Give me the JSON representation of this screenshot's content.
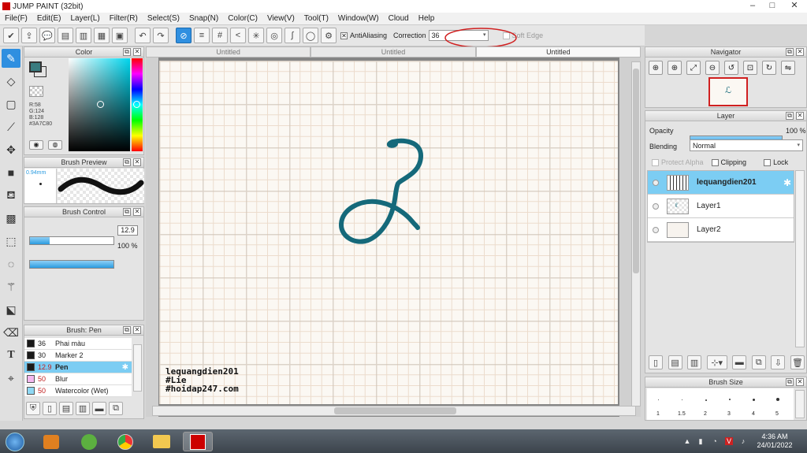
{
  "app": {
    "title": "JUMP PAINT (32bit)",
    "window_controls": [
      "–",
      "□",
      "✕"
    ]
  },
  "menu": [
    "File(F)",
    "Edit(E)",
    "Layer(L)",
    "Filter(R)",
    "Select(S)",
    "Snap(N)",
    "Color(C)",
    "View(V)",
    "Tool(T)",
    "Window(W)",
    "Cloud",
    "Help"
  ],
  "toolbar": {
    "antialiasing_label": "AntiAliasing",
    "correction_label": "Correction",
    "correction_value": "36",
    "soft_edge_label": "Soft Edge"
  },
  "color_panel": {
    "title": "Color",
    "r": "R:58",
    "g": "G:124",
    "b": "B:128",
    "hex": "#3A7C80",
    "current_color": "#3a7c80"
  },
  "brush_preview": {
    "title": "Brush Preview",
    "size_label": "0.94mm"
  },
  "brush_control": {
    "title": "Brush Control",
    "size_value": "12.9",
    "opacity_value": "100 %",
    "size_fraction": 0.24,
    "opacity_fraction": 1.0
  },
  "brush_list": {
    "title": "Brush: Pen",
    "items": [
      {
        "size": "36",
        "name": "Phai màu",
        "color": "#1a1a1a"
      },
      {
        "size": "30",
        "name": "Marker 2",
        "color": "#1a1a1a"
      },
      {
        "size": "12.9",
        "name": "Pen",
        "color": "#1a1a1a"
      },
      {
        "size": "50",
        "name": "Blur",
        "color": "#f4b8f0"
      },
      {
        "size": "50",
        "name": "Watercolor (Wet)",
        "color": "#8fd8f4"
      }
    ]
  },
  "tabs": [
    "Untitled",
    "Untitled",
    "Untitled"
  ],
  "canvas": {
    "stroke_color": "#15697a",
    "watermark": [
      "lequangdien201",
      "#Lie",
      "#hoidap247.com"
    ]
  },
  "navigator": {
    "title": "Navigator"
  },
  "layer_panel": {
    "title": "Layer",
    "opacity_label": "Opacity",
    "opacity_value": "100 %",
    "blending_label": "Blending",
    "blending_value": "Normal",
    "protect_alpha_label": "Protect Alpha",
    "clipping_label": "Clipping",
    "lock_label": "Lock",
    "layers": [
      {
        "name": "lequangdien201"
      },
      {
        "name": "Layer1"
      },
      {
        "name": "Layer2"
      }
    ]
  },
  "brush_size": {
    "title": "Brush Size",
    "labels": [
      "1",
      "1.5",
      "2",
      "3",
      "4",
      "5"
    ]
  },
  "taskbar": {
    "time": "4:36 AM",
    "date": "24/01/2022"
  }
}
